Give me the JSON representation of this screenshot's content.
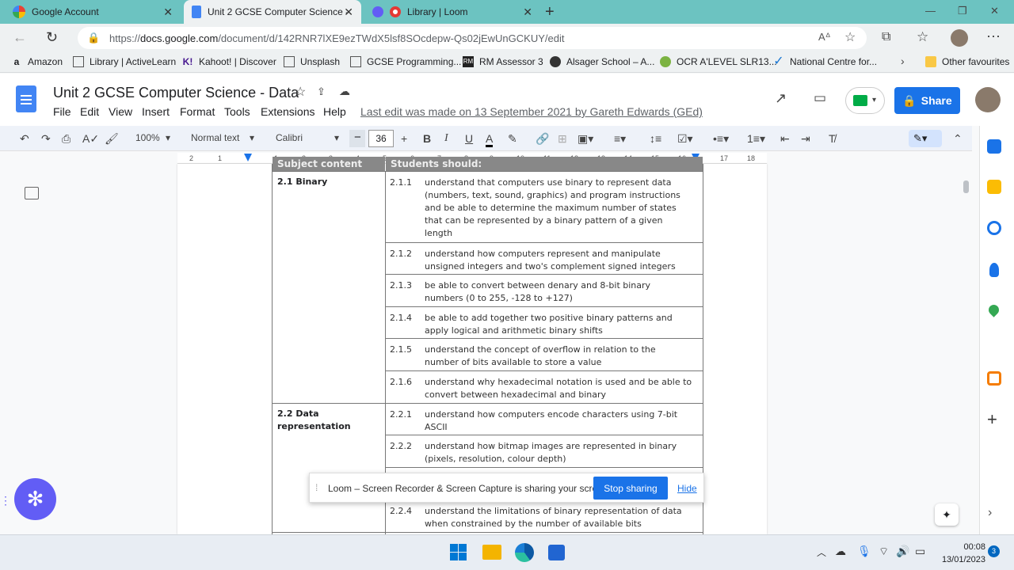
{
  "browser": {
    "tabs": [
      {
        "title": "Google Account",
        "active": false
      },
      {
        "title": "Unit 2 GCSE Computer Science -",
        "active": true
      },
      {
        "title": "Library | Loom",
        "active": false
      }
    ],
    "url_prefix": "https://",
    "url_domain": "docs.google.com",
    "url_path": "/document/d/142RNR7lXE9ezTWdX5lsf8SOcdepw-Qs02jEwUnGCKUY/edit",
    "bookmarks": [
      "Amazon",
      "Library | ActiveLearn",
      "Kahoot! | Discover",
      "Unsplash",
      "GCSE Programming...",
      "RM Assessor 3",
      "Alsager School – A...",
      "OCR A'LEVEL SLR13...",
      "National Centre for..."
    ],
    "other_favourites": "Other favourites"
  },
  "docs": {
    "title": "Unit 2 GCSE Computer Science - Data",
    "menus": [
      "File",
      "Edit",
      "View",
      "Insert",
      "Format",
      "Tools",
      "Extensions",
      "Help"
    ],
    "last_edit": "Last edit was made on 13 September 2021 by Gareth Edwards (GEd)",
    "share_label": "Share",
    "toolbar": {
      "zoom": "100%",
      "style": "Normal text",
      "font": "Calibri",
      "font_size": "36"
    },
    "ruler_numbers": [
      "2",
      "1",
      "1",
      "2",
      "3",
      "4",
      "5",
      "6",
      "7",
      "8",
      "9",
      "10",
      "11",
      "12",
      "13",
      "14",
      "15",
      "16",
      "17",
      "18"
    ]
  },
  "table": {
    "header_left": "Subject content",
    "header_right": "Students should:",
    "sections": [
      {
        "title": "2.1 Binary",
        "rows": [
          {
            "num": "2.1.1",
            "text": [
              "understand that computers use binary to represent data",
              "(numbers, text, sound, graphics) and program instructions",
              "and be able to determine the maximum number of states",
              "that can be represented by a binary pattern of a given",
              "length"
            ]
          },
          {
            "num": "2.1.2",
            "text": [
              "understand how computers represent and manipulate",
              "unsigned integers and two's complement signed integers"
            ]
          },
          {
            "num": "2.1.3",
            "text": [
              "be able to convert between denary and 8-bit binary",
              "numbers (0 to 255, -128 to +127)"
            ]
          },
          {
            "num": "2.1.4",
            "text": [
              "be able to add together two positive binary patterns and",
              "apply logical and arithmetic binary shifts"
            ]
          },
          {
            "num": "2.1.5",
            "text": [
              "understand the concept of overflow in relation to the",
              "number of bits available to store a value"
            ]
          },
          {
            "num": "2.1.6",
            "text": [
              "understand why hexadecimal notation is used and be able to",
              "convert between hexadecimal and binary"
            ]
          }
        ]
      },
      {
        "title_lines": [
          "2.2 Data",
          "representation"
        ],
        "rows": [
          {
            "num": "2.2.1",
            "text": [
              "understand how computers encode characters using 7-bit",
              "ASCII"
            ]
          },
          {
            "num": "2.2.2",
            "text": [
              "understand how bitmap images are represented in binary",
              "(pixels, resolution, colour depth)"
            ]
          },
          {
            "num": "2.2.4",
            "text": [
              "understand the limitations of binary representation of data",
              "when constrained by the number of available bits"
            ]
          }
        ]
      }
    ]
  },
  "loom": {
    "message": "Loom – Screen Recorder & Screen Capture is sharing your screen.",
    "stop_label": "Stop sharing",
    "hide_label": "Hide"
  },
  "taskbar": {
    "time": "00:08",
    "date": "13/01/2023",
    "notifications": "3"
  }
}
